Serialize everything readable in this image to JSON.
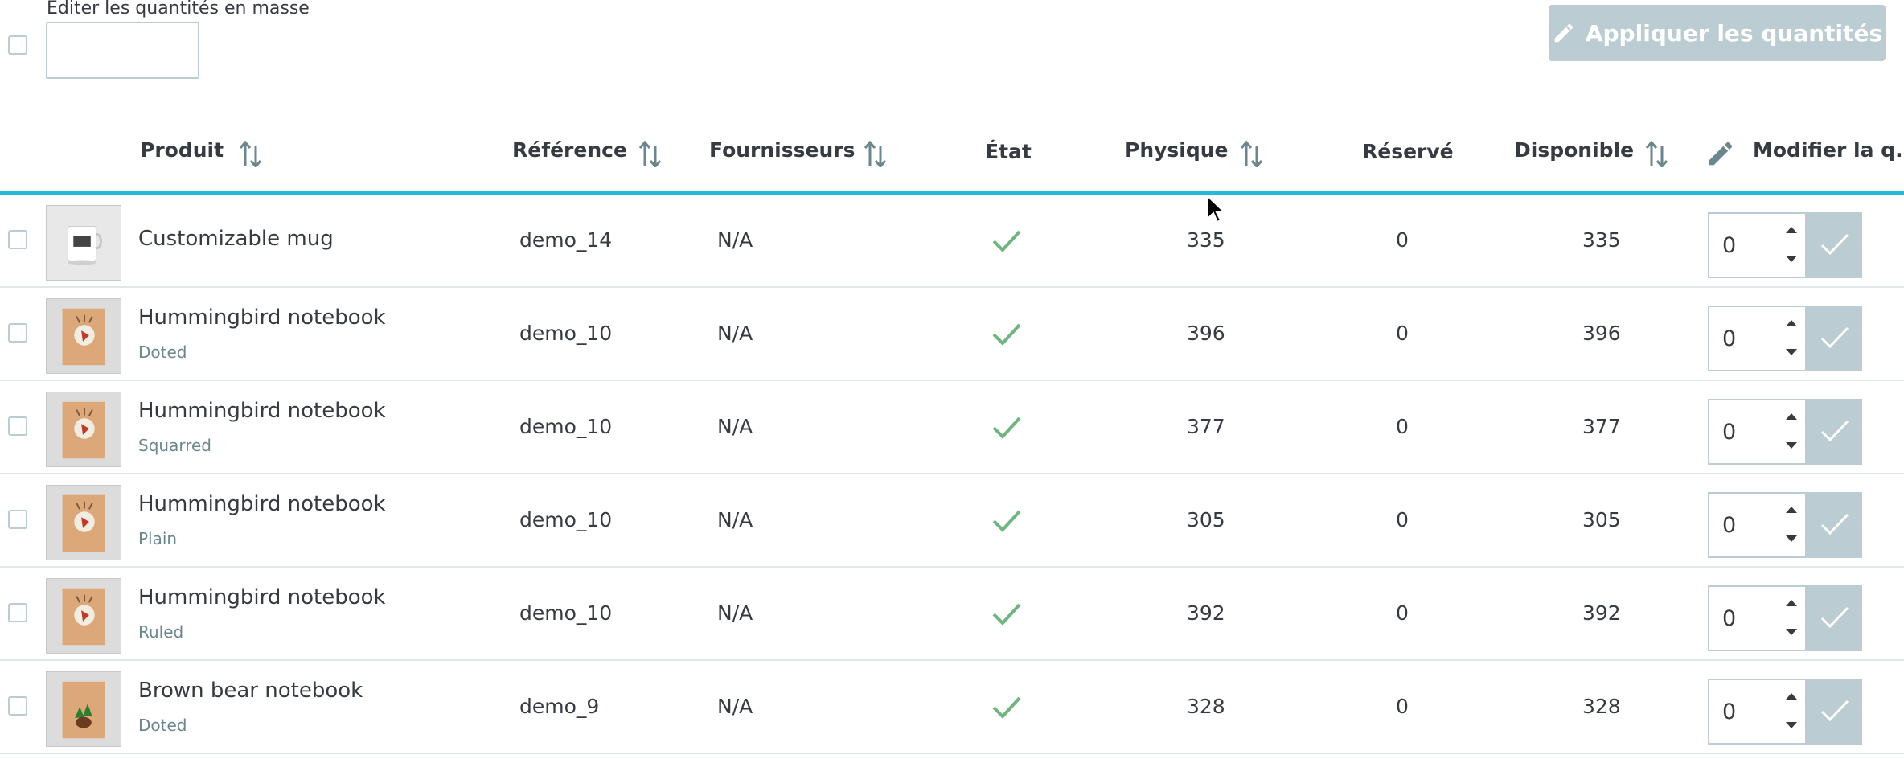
{
  "bulk": {
    "label": "Editer les quantités en masse",
    "input_value": "",
    "apply_label": "Appliquer les quantités"
  },
  "columns": {
    "produit": "Produit",
    "reference": "Référence",
    "fournisseurs": "Fournisseurs",
    "etat": "État",
    "physique": "Physique",
    "reserve": "Réservé",
    "disponible": "Disponible",
    "modifier": "Modifier la q..."
  },
  "rows": [
    {
      "name": "Customizable mug",
      "attr": "",
      "ref": "demo_14",
      "supplier": "N/A",
      "physique": "335",
      "reserve": "0",
      "disponible": "335",
      "qty": "0"
    },
    {
      "name": "Hummingbird notebook",
      "attr": "Doted",
      "ref": "demo_10",
      "supplier": "N/A",
      "physique": "396",
      "reserve": "0",
      "disponible": "396",
      "qty": "0"
    },
    {
      "name": "Hummingbird notebook",
      "attr": "Squarred",
      "ref": "demo_10",
      "supplier": "N/A",
      "physique": "377",
      "reserve": "0",
      "disponible": "377",
      "qty": "0"
    },
    {
      "name": "Hummingbird notebook",
      "attr": "Plain",
      "ref": "demo_10",
      "supplier": "N/A",
      "physique": "305",
      "reserve": "0",
      "disponible": "305",
      "qty": "0"
    },
    {
      "name": "Hummingbird notebook",
      "attr": "Ruled",
      "ref": "demo_10",
      "supplier": "N/A",
      "physique": "392",
      "reserve": "0",
      "disponible": "392",
      "qty": "0"
    },
    {
      "name": "Brown bear notebook",
      "attr": "Doted",
      "ref": "demo_9",
      "supplier": "N/A",
      "physique": "328",
      "reserve": "0",
      "disponible": "328",
      "qty": "0"
    }
  ],
  "icons": {
    "sort": "sort-arrows-icon",
    "state_ok": "check-icon",
    "edit": "pencil-icon"
  },
  "colors": {
    "accent": "#25b9d7",
    "check_green": "#70b580",
    "disabled_button": "#bbcdd2",
    "muted_text": "#6c868e"
  }
}
